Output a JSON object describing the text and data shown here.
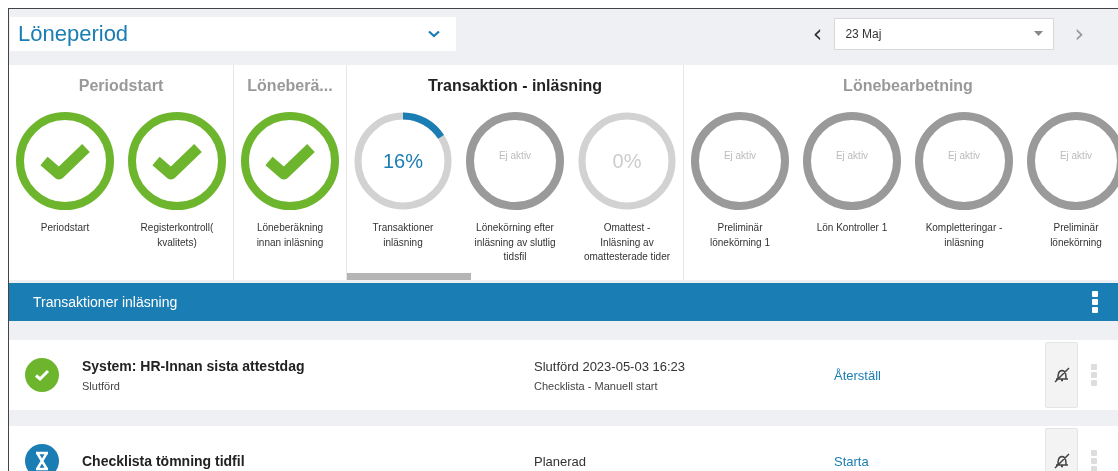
{
  "period_select": {
    "value": "Löneperiod"
  },
  "date_nav": {
    "prev": "‹",
    "value": "23 Maj",
    "next": "›"
  },
  "phases": [
    {
      "title": "Periodstart",
      "active": false,
      "steps": [
        {
          "kind": "done",
          "label": "Periodstart",
          "selected": false
        },
        {
          "kind": "done",
          "label": "Registerkontroll( kvalitets)",
          "selected": false
        }
      ]
    },
    {
      "title": "Löneberä...",
      "active": false,
      "steps": [
        {
          "kind": "done",
          "label": "Löneberäkning innan inläsning",
          "selected": false
        }
      ]
    },
    {
      "title": "Transaktion - inläsning",
      "active": true,
      "steps": [
        {
          "kind": "progress",
          "level": 0.16,
          "center": "16%",
          "label": "Transaktioner inläsning",
          "selected": true
        },
        {
          "kind": "inactive",
          "center": "Ej aktiv",
          "label": "Lönekörning efter inläsning av slutlig tidsfil",
          "selected": false
        },
        {
          "kind": "progress",
          "level": 0,
          "center": "0%",
          "label": "Omattest - Inläsning av omattesterade tider",
          "selected": false
        }
      ]
    },
    {
      "title": "Lönebearbetning",
      "active": false,
      "steps": [
        {
          "kind": "inactive",
          "center": "Ej aktiv",
          "label": "Preliminär lönekörning 1",
          "selected": false
        },
        {
          "kind": "inactive",
          "center": "Ej aktiv",
          "label": "Lön Kontroller 1",
          "selected": false
        },
        {
          "kind": "inactive",
          "center": "Ej aktiv",
          "label": "Kompletteringar - inläsning",
          "selected": false
        },
        {
          "kind": "inactive",
          "center": "Ej aktiv",
          "label": "Preliminär lönekörning",
          "selected": false
        }
      ]
    }
  ],
  "section": {
    "title": "Transaktioner inläsning"
  },
  "tasks": [
    {
      "kind": "done",
      "title": "System: HR-Innan sista attestdag",
      "status": "Slutförd",
      "state": "Slutförd 2023-05-03 16:23",
      "type": "Checklista - Manuell start",
      "action": "Återställ"
    },
    {
      "kind": "planned",
      "title": "Checklista tömning tidfil",
      "state": "Planerad",
      "action": "Starta"
    }
  ]
}
